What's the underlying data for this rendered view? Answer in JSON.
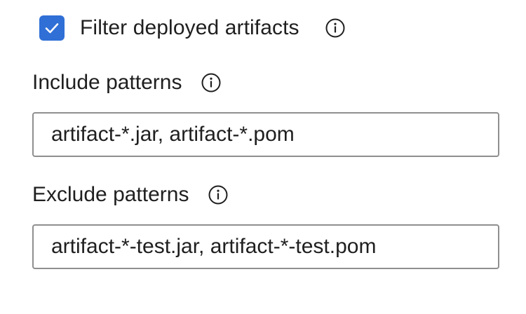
{
  "filter": {
    "label": "Filter deployed artifacts",
    "checked": true,
    "checkbox_icon": "checkmark-icon",
    "info_icon": "info-icon",
    "accent_color": "#2f6fd6"
  },
  "include": {
    "label": "Include patterns",
    "value": "artifact-*.jar, artifact-*.pom",
    "info_icon": "info-icon"
  },
  "exclude": {
    "label": "Exclude patterns",
    "value": "artifact-*-test.jar, artifact-*-test.pom",
    "info_icon": "info-icon"
  }
}
